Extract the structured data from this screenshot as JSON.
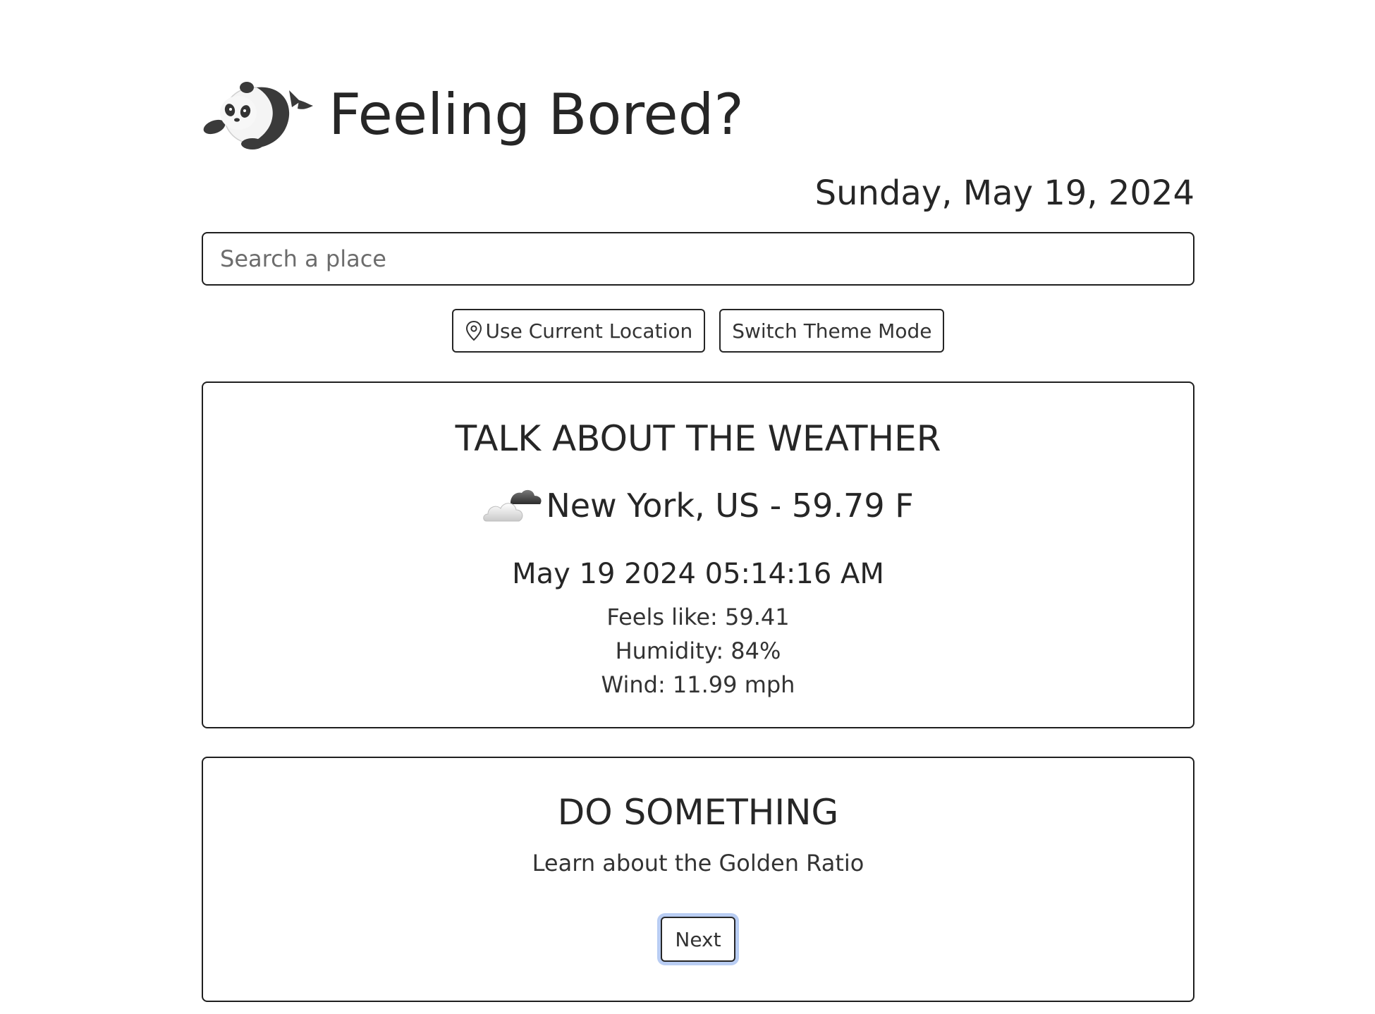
{
  "header": {
    "title": "Feeling Bored?",
    "logo_icon": "panda-icon"
  },
  "date": "Sunday, May 19, 2024",
  "search": {
    "placeholder": "Search a place",
    "value": ""
  },
  "buttons": {
    "location_label": "Use Current Location",
    "location_icon": "map-pin-icon",
    "theme_label": "Switch Theme Mode"
  },
  "weather": {
    "title": "TALK ABOUT THE WEATHER",
    "icon": "partly-cloudy-icon",
    "location": "New York, US - 59.79 F",
    "datetime": "May 19 2024 05:14:16 AM",
    "feels_like": "Feels like: 59.41",
    "humidity": "Humidity: 84%",
    "wind": "Wind: 11.99 mph"
  },
  "activity": {
    "title": "DO SOMETHING",
    "suggestion": "Learn about the Golden Ratio",
    "next_label": "Next"
  },
  "colors": {
    "text": "#262626",
    "border": "#1f1f1f",
    "focus_ring": "#b9cdf3",
    "background": "#ffffff"
  }
}
